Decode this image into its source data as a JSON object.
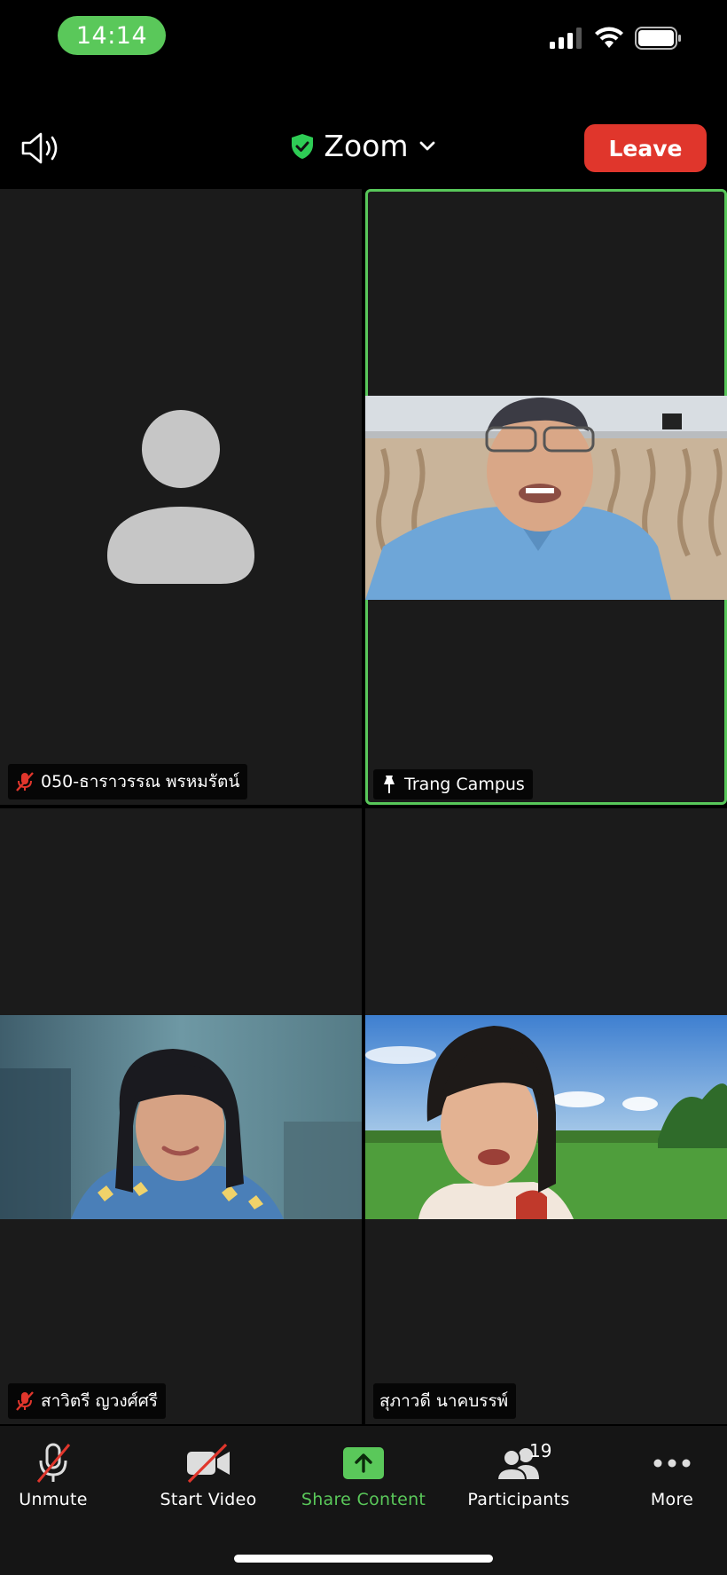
{
  "status_bar": {
    "time": "14:14"
  },
  "header": {
    "title": "Zoom",
    "leave_label": "Leave"
  },
  "tiles": [
    {
      "name": "050-ธาราวรรณ พรหมรัตน์",
      "muted": true,
      "video": false
    },
    {
      "name": "Trang Campus",
      "muted": false,
      "pinned": true,
      "video": true,
      "active": true
    },
    {
      "name": "สาวิตรี ญวงศ์ศรี",
      "muted": true,
      "video": true
    },
    {
      "name": "สุภาวดี นาคบรรพ์",
      "muted": false,
      "video": true
    }
  ],
  "toolbar": {
    "unmute": "Unmute",
    "start_video": "Start Video",
    "share_content": "Share Content",
    "participants": "Participants",
    "participants_count": "19",
    "more": "More"
  },
  "colors": {
    "accent_green": "#5ac85a",
    "leave_red": "#e0362c",
    "tile_bg": "#1b1b1b"
  }
}
